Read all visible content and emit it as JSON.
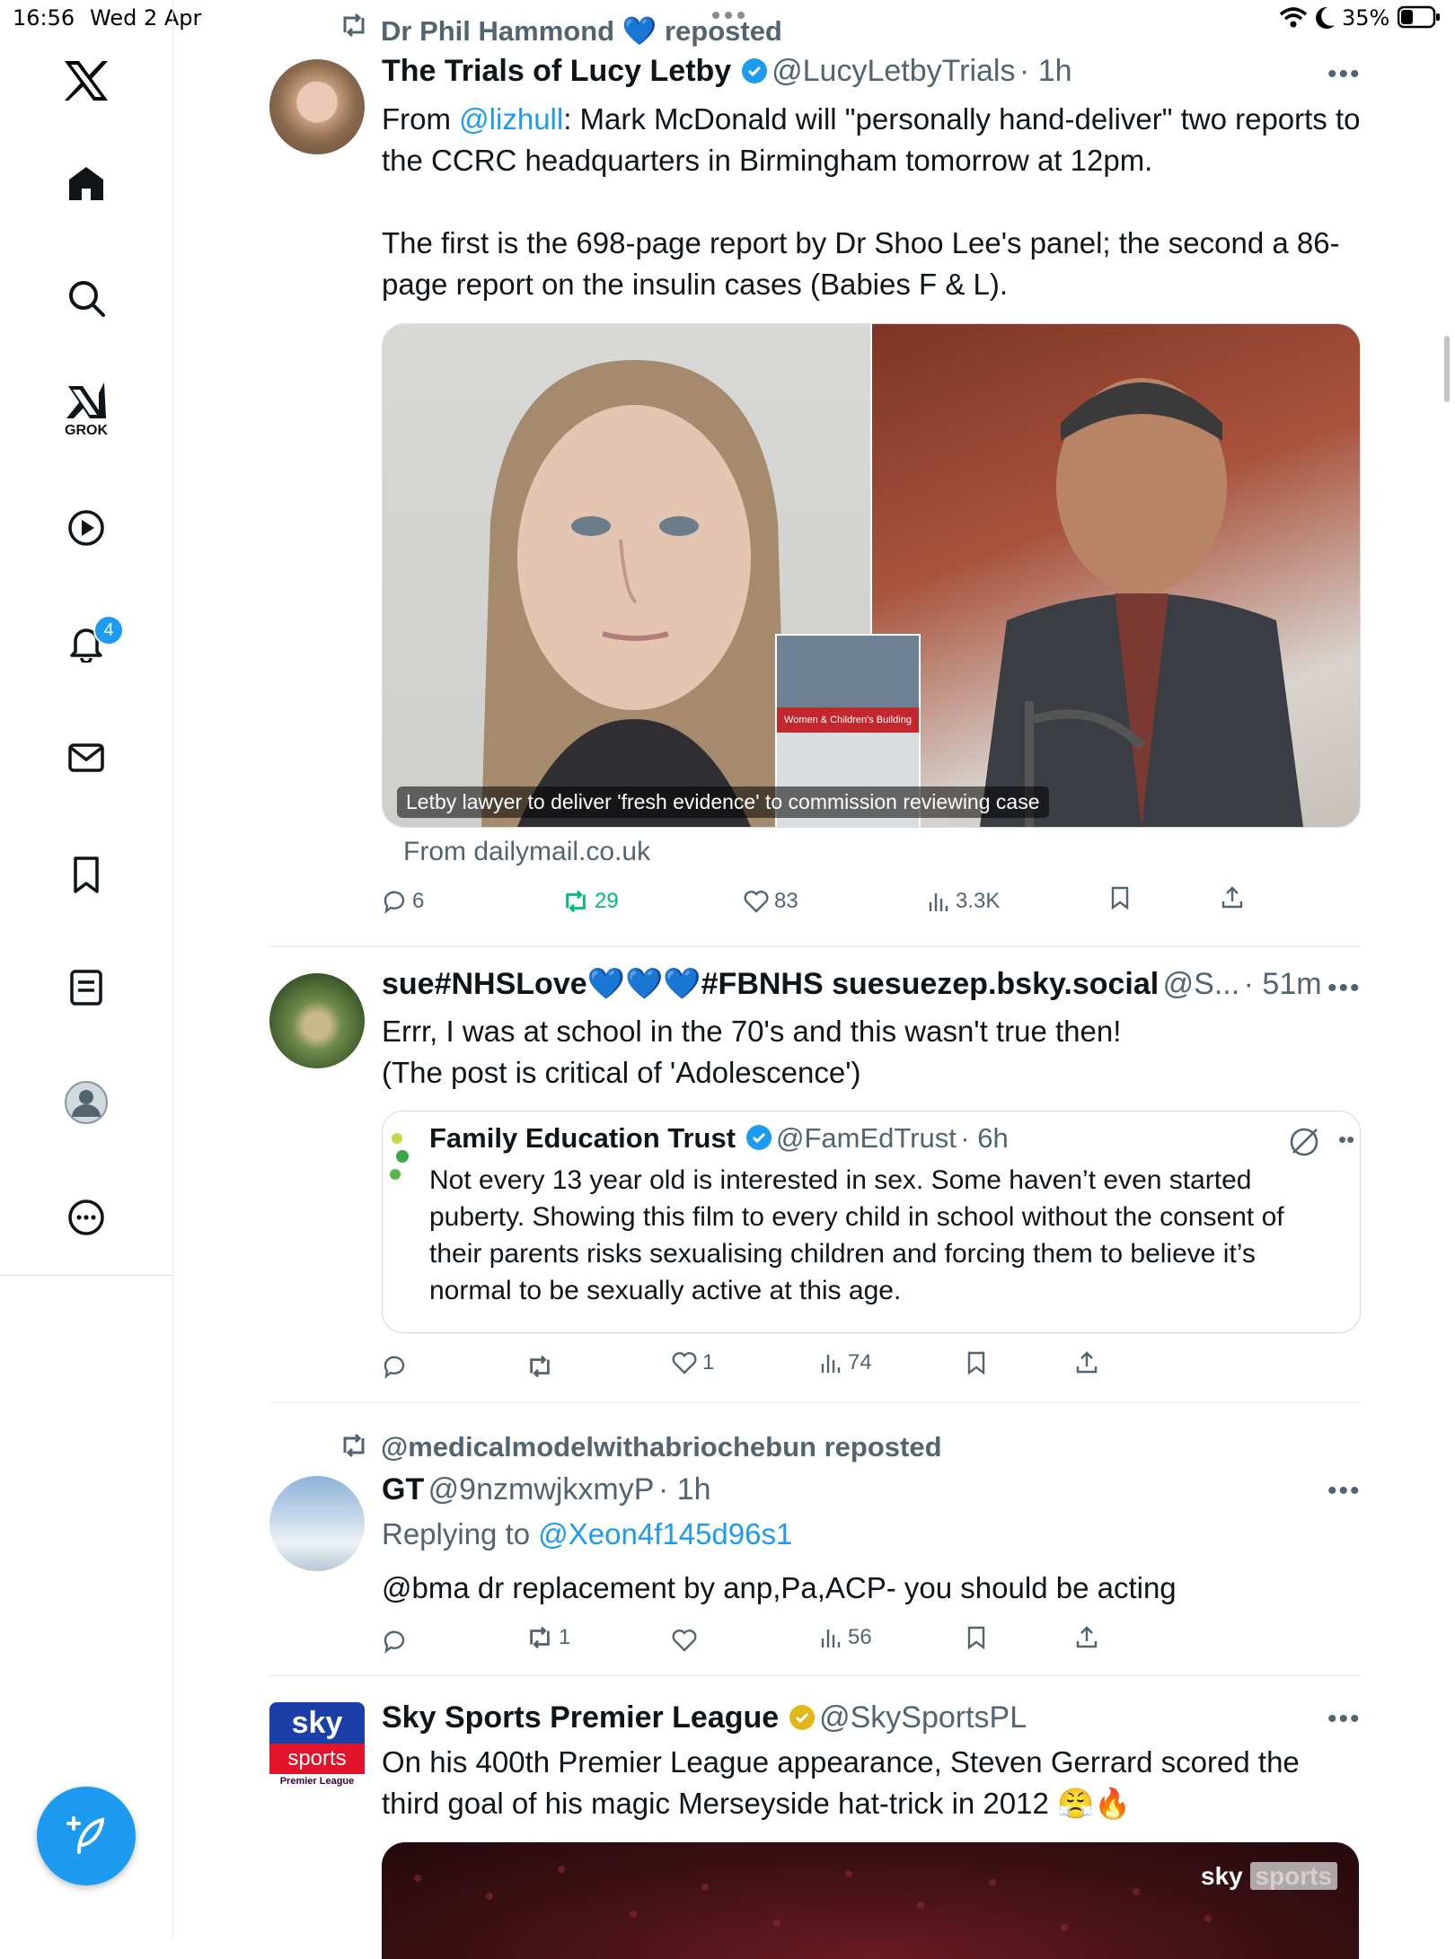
{
  "status_bar": {
    "time": "16:56",
    "date": "Wed 2 Apr",
    "battery": "35%"
  },
  "sidebar": {
    "grok_label": "GROK",
    "notifications_badge": "4"
  },
  "tweets": [
    {
      "repost_by": "Dr Phil Hammond",
      "repost_suffix": "reposted",
      "name": "The Trials of Lucy Letby",
      "handle": "@LucyLetbyTrials",
      "time": "· 1h",
      "text_from": "From ",
      "mention": "@lizhull",
      "text_1": ": Mark McDonald will \"personally hand-deliver\" two reports to the CCRC headquarters in Birmingham tomorrow at 12pm.",
      "text_2": "The first is the 698-page report by Dr Shoo Lee's panel; the second a 86-page report on the insulin cases (Babies F & L).",
      "media_inset_text": "Women & Children's Building",
      "card_caption": "Letby lawyer to deliver 'fresh evidence' to commission reviewing case",
      "card_source": "From dailymail.co.uk",
      "replies": "6",
      "reposts": "29",
      "likes": "83",
      "views": "3.3K"
    },
    {
      "name": "sue#NHSLove💙💙💙#FBNHS suesuezep.bsky.social",
      "handle": "@S...",
      "time": "· 51m",
      "text_1": "Errr, I was at school in the 70's and this wasn't true then!",
      "text_2": "(The post is critical of 'Adolescence')",
      "quote": {
        "name": "Family Education Trust",
        "handle": "@FamEdTrust",
        "time": "· 6h",
        "text": "Not every 13 year old is interested in sex. Some haven’t even started puberty. Showing this film to every child in school without the consent of their parents risks sexualising children and forcing them to believe it’s normal to be sexually active at this age."
      },
      "replies": "",
      "reposts": "",
      "likes": "1",
      "views": "74"
    },
    {
      "repost_by": "@medicalmodelwithabriochebun",
      "repost_suffix": "reposted",
      "name": "GT",
      "handle": "@9nzmwjkxmyP",
      "time": "· 1h",
      "replying_prefix": "Replying to ",
      "replying_to": "@Xeon4f145d96s1",
      "text_1": "@bma dr replacement by anp,Pa,ACP- you should be acting",
      "replies": "",
      "reposts": "1",
      "likes": "",
      "views": "56"
    },
    {
      "name": "Sky Sports Premier League",
      "handle": "@SkySportsPL",
      "text_1": "On his 400th Premier League appearance, Steven Gerrard scored the third goal of his magic Merseyside hat-trick in 2012 😤🔥",
      "logo_top": "sky",
      "logo_mid": "sports",
      "logo_bottom": "Premier League",
      "watermark_a": "sky",
      "watermark_b": "sports"
    }
  ],
  "colors": {
    "accent": "#1d9bf0",
    "text": "#0f1419",
    "muted": "#536471",
    "repost_green": "#00ba7c",
    "gold": "#e2b719"
  }
}
